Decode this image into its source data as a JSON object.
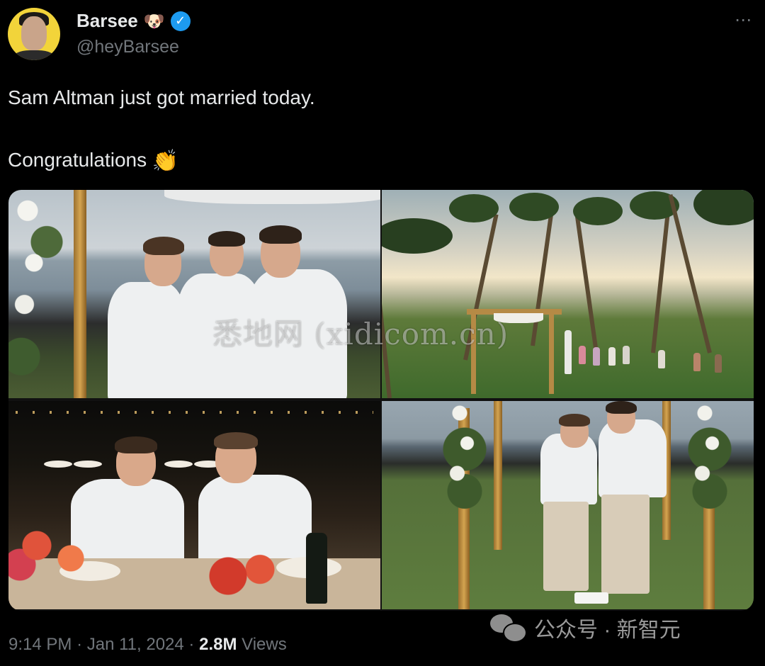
{
  "author": {
    "display_name": "Barsee",
    "name_emoji": "🐶",
    "handle": "@heyBarsee",
    "verified": true
  },
  "tweet": {
    "line1": "Sam Altman just got married today.",
    "line2": "Congratulations",
    "line2_emoji": "👏"
  },
  "more_icon": "⋯",
  "watermark": "悉地网 (xidicom.cn)",
  "meta": {
    "time": "9:14 PM",
    "date": "Jan 11, 2024",
    "sep": "·",
    "views_count": "2.8M",
    "views_label": "Views"
  },
  "wechat_credit": {
    "text": "公众号 · 新智元"
  },
  "colors": {
    "background": "#000000",
    "text": "#e7e9ea",
    "secondary": "#71767b",
    "verified": "#1d9bf0"
  }
}
